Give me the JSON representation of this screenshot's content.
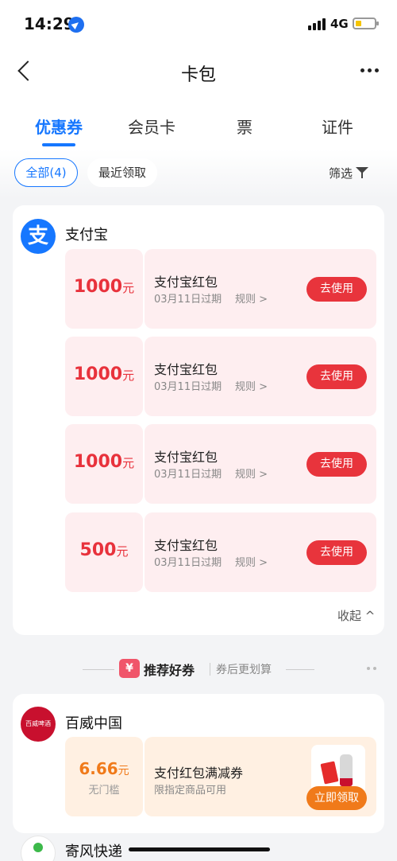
{
  "status_bar": {
    "time": "14:29",
    "network": "4G"
  },
  "nav": {
    "title": "卡包"
  },
  "tabs": [
    {
      "label": "优惠券",
      "active": true
    },
    {
      "label": "会员卡",
      "active": false
    },
    {
      "label": "票",
      "active": false
    },
    {
      "label": "证件",
      "active": false
    }
  ],
  "filters": {
    "all": "全部(4)",
    "recent": "最近领取",
    "filter": "筛选"
  },
  "alipay": {
    "logo_char": "支",
    "brand": "支付宝",
    "coupons": [
      {
        "amount": "1000",
        "unit": "元",
        "name": "支付宝红包",
        "expiry": "03月11日过期",
        "rule": "规则 >",
        "action": "去使用"
      },
      {
        "amount": "1000",
        "unit": "元",
        "name": "支付宝红包",
        "expiry": "03月11日过期",
        "rule": "规则 >",
        "action": "去使用"
      },
      {
        "amount": "1000",
        "unit": "元",
        "name": "支付宝红包",
        "expiry": "03月11日过期",
        "rule": "规则 >",
        "action": "去使用"
      },
      {
        "amount": "500",
        "unit": "元",
        "name": "支付宝红包",
        "expiry": "03月11日过期",
        "rule": "规则 >",
        "action": "去使用"
      }
    ],
    "collapse": "收起 ^"
  },
  "recommend": {
    "badge": "¥",
    "title": "推荐好券",
    "subtitle": "券后更划算"
  },
  "budweiser": {
    "brand": "百威中国",
    "offer": {
      "amount": "6.66",
      "unit": "元",
      "threshold": "无门槛",
      "name": "支付红包满减券",
      "desc": "限指定商品可用",
      "action": "立即领取"
    }
  },
  "next_brand": {
    "brand": "寄风快递"
  },
  "colors": {
    "accent": "#1677ff",
    "coupon_red": "#e8343c",
    "offer_orange": "#f07a1a"
  }
}
